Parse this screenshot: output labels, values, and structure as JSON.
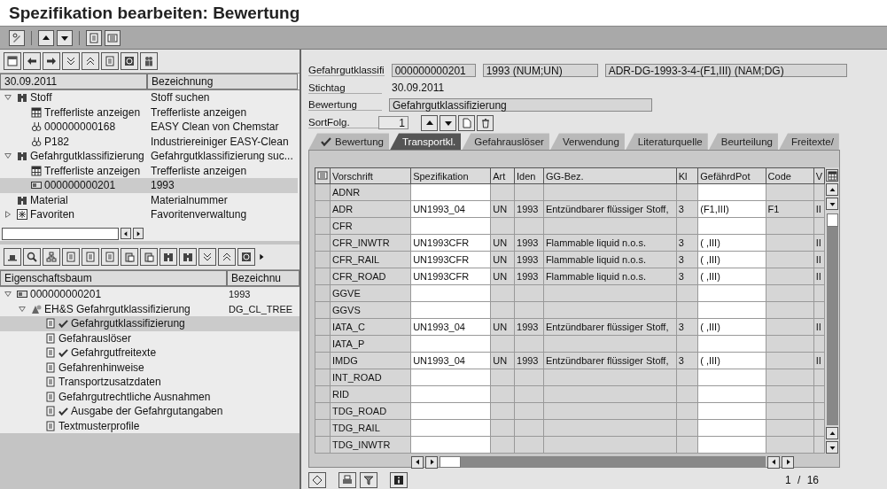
{
  "window": {
    "title": "Spezifikation bearbeiten: Bewertung"
  },
  "search_tree": {
    "columns": [
      "30.09.2011",
      "Bezeichnung"
    ],
    "items": [
      {
        "label": "Stoff",
        "description": "Stoff suchen",
        "kind": "binoculars",
        "expanded": true,
        "selected": false,
        "children": [
          {
            "label": "Trefferliste anzeigen",
            "description": "Trefferliste anzeigen",
            "kind": "grid",
            "selected": false
          },
          {
            "label": "000000000168",
            "description": "EASY Clean von Chemstar",
            "kind": "flasks",
            "selected": false
          },
          {
            "label": "P182",
            "description": "Industriereiniger EASY-Clean",
            "kind": "flasks",
            "selected": false
          }
        ]
      },
      {
        "label": "Gefahrgutklassifizierung",
        "description": "Gefahrgutklassifizierung suc...",
        "kind": "binoculars",
        "expanded": true,
        "selected": false,
        "children": [
          {
            "label": "Trefferliste anzeigen",
            "description": "Trefferliste anzeigen",
            "kind": "grid",
            "selected": false
          },
          {
            "label": "000000000201",
            "description": "1993",
            "kind": "card",
            "selected": true
          }
        ]
      },
      {
        "label": "Material",
        "description": "Materialnummer",
        "kind": "binoculars",
        "selected": false
      },
      {
        "label": "Favoriten",
        "description": "Favoritenverwaltung",
        "kind": "star",
        "expanded": false,
        "selected": false
      }
    ]
  },
  "property_tree": {
    "columns": [
      "Eigenschaftsbaum",
      "Bezeichnu"
    ],
    "items": [
      {
        "label": "000000000201",
        "description": "1993",
        "kind": "card",
        "expanded": true,
        "selected": false,
        "done": false,
        "children": [
          {
            "label": "EH&S Gefahrgutklassifizierung",
            "description": "DG_CL_TREE",
            "kind": "hazard",
            "expanded": true,
            "selected": false,
            "done": false,
            "children": [
              {
                "label": "Gefahrgutklassifizierung",
                "kind": "doc",
                "selected": true,
                "done": true
              },
              {
                "label": "Gefahrauslöser",
                "kind": "doc",
                "selected": false,
                "done": false
              },
              {
                "label": "Gefahrgutfreitexte",
                "kind": "doc",
                "selected": false,
                "done": true
              },
              {
                "label": "Gefahrenhinweise",
                "kind": "doc",
                "selected": false,
                "done": false
              },
              {
                "label": "Transportzusatzdaten",
                "kind": "doc",
                "selected": false,
                "done": false
              },
              {
                "label": "Gefahrgutrechtliche Ausnahmen",
                "kind": "doc",
                "selected": false,
                "done": false
              },
              {
                "label": "Ausgabe der Gefahrgutangaben",
                "kind": "doc",
                "selected": false,
                "done": true
              },
              {
                "label": "Textmusterprofile",
                "kind": "doc",
                "selected": false,
                "done": false
              }
            ]
          }
        ]
      }
    ]
  },
  "fields": [
    {
      "kind": "multi",
      "label": "Gefahrgutklassifi",
      "values": [
        "000000000201",
        "1993 (NUM;UN)",
        "ADR-DG-1993-3-4-(F1,III) (NAM;DG)"
      ]
    },
    {
      "kind": "text",
      "label": "Stichtag",
      "value": "30.09.2011"
    },
    {
      "kind": "field",
      "label": "Bewertung",
      "value": "Gefahrgutklassifizierung"
    },
    {
      "kind": "sort",
      "label": "SortFolg.",
      "value": "1"
    }
  ],
  "tabs": [
    {
      "label": "Bewertung",
      "selected": false,
      "done": true
    },
    {
      "label": "Transportkl.",
      "selected": true,
      "done": false
    },
    {
      "label": "Gefahrauslöser",
      "selected": false,
      "done": false
    },
    {
      "label": "Verwendung",
      "selected": false,
      "done": false
    },
    {
      "label": "Literaturquelle",
      "selected": false,
      "done": false
    },
    {
      "label": "Beurteilung",
      "selected": false,
      "done": false
    },
    {
      "label": "Freitexte/",
      "selected": false,
      "done": false
    }
  ],
  "table": {
    "columns": [
      {
        "label": "Vorschrift",
        "editable": false
      },
      {
        "label": "Spezifikation",
        "editable": true
      },
      {
        "label": "Art",
        "editable": false
      },
      {
        "label": "Iden",
        "editable": false
      },
      {
        "label": "GG-Bez.",
        "editable": false
      },
      {
        "label": "Kl",
        "editable": false
      },
      {
        "label": "GefährdPot",
        "editable": true
      },
      {
        "label": "Code",
        "editable": false
      },
      {
        "label": "V",
        "editable": false
      }
    ],
    "rows": [
      [
        "ADNR",
        null,
        null,
        null,
        null,
        null,
        null,
        null,
        null
      ],
      [
        "ADR",
        "UN1993_04",
        "UN",
        "1993",
        "Entzündbarer flüssiger Stoff,",
        "3",
        "(F1,III)",
        "F1",
        "II"
      ],
      [
        "CFR",
        null,
        null,
        null,
        null,
        null,
        null,
        null,
        null
      ],
      [
        "CFR_INWTR",
        "UN1993CFR",
        "UN",
        "1993",
        "Flammable liquid n.o.s.",
        "3",
        "( ,III)",
        null,
        "II"
      ],
      [
        "CFR_RAIL",
        "UN1993CFR",
        "UN",
        "1993",
        "Flammable liquid n.o.s.",
        "3",
        "( ,III)",
        null,
        "II"
      ],
      [
        "CFR_ROAD",
        "UN1993CFR",
        "UN",
        "1993",
        "Flammable liquid n.o.s.",
        "3",
        "( ,III)",
        null,
        "II"
      ],
      [
        "GGVE",
        null,
        null,
        null,
        null,
        null,
        null,
        null,
        null
      ],
      [
        "GGVS",
        null,
        null,
        null,
        null,
        null,
        null,
        null,
        null
      ],
      [
        "IATA_C",
        "UN1993_04",
        "UN",
        "1993",
        "Entzündbarer flüssiger Stoff,",
        "3",
        "( ,III)",
        null,
        "II"
      ],
      [
        "IATA_P",
        null,
        null,
        null,
        null,
        null,
        null,
        null,
        null
      ],
      [
        "IMDG",
        "UN1993_04",
        "UN",
        "1993",
        "Entzündbarer flüssiger Stoff,",
        "3",
        "( ,III)",
        null,
        "II"
      ],
      [
        "INT_ROAD",
        null,
        null,
        null,
        null,
        null,
        null,
        null,
        null
      ],
      [
        "RID",
        null,
        null,
        null,
        null,
        null,
        null,
        null,
        null
      ],
      [
        "TDG_ROAD",
        null,
        null,
        null,
        null,
        null,
        null,
        null,
        null
      ],
      [
        "TDG_RAIL",
        null,
        null,
        null,
        null,
        null,
        null,
        null,
        null
      ],
      [
        "TDG_INWTR",
        null,
        null,
        null,
        null,
        null,
        null,
        null,
        null
      ]
    ]
  },
  "pager": "1 / 16"
}
